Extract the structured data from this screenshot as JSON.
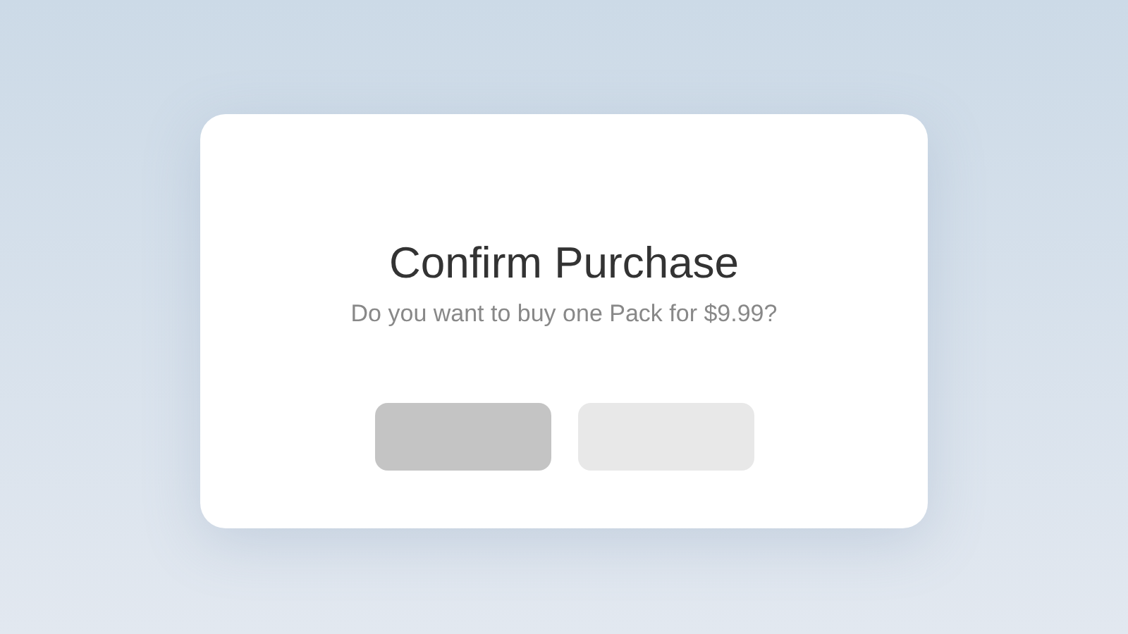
{
  "dialog": {
    "title": "Confirm Purchase",
    "message": "Do you want to buy one Pack for $9.99?",
    "buttons": [
      {
        "kind": "primary"
      },
      {
        "kind": "secondary"
      }
    ]
  }
}
